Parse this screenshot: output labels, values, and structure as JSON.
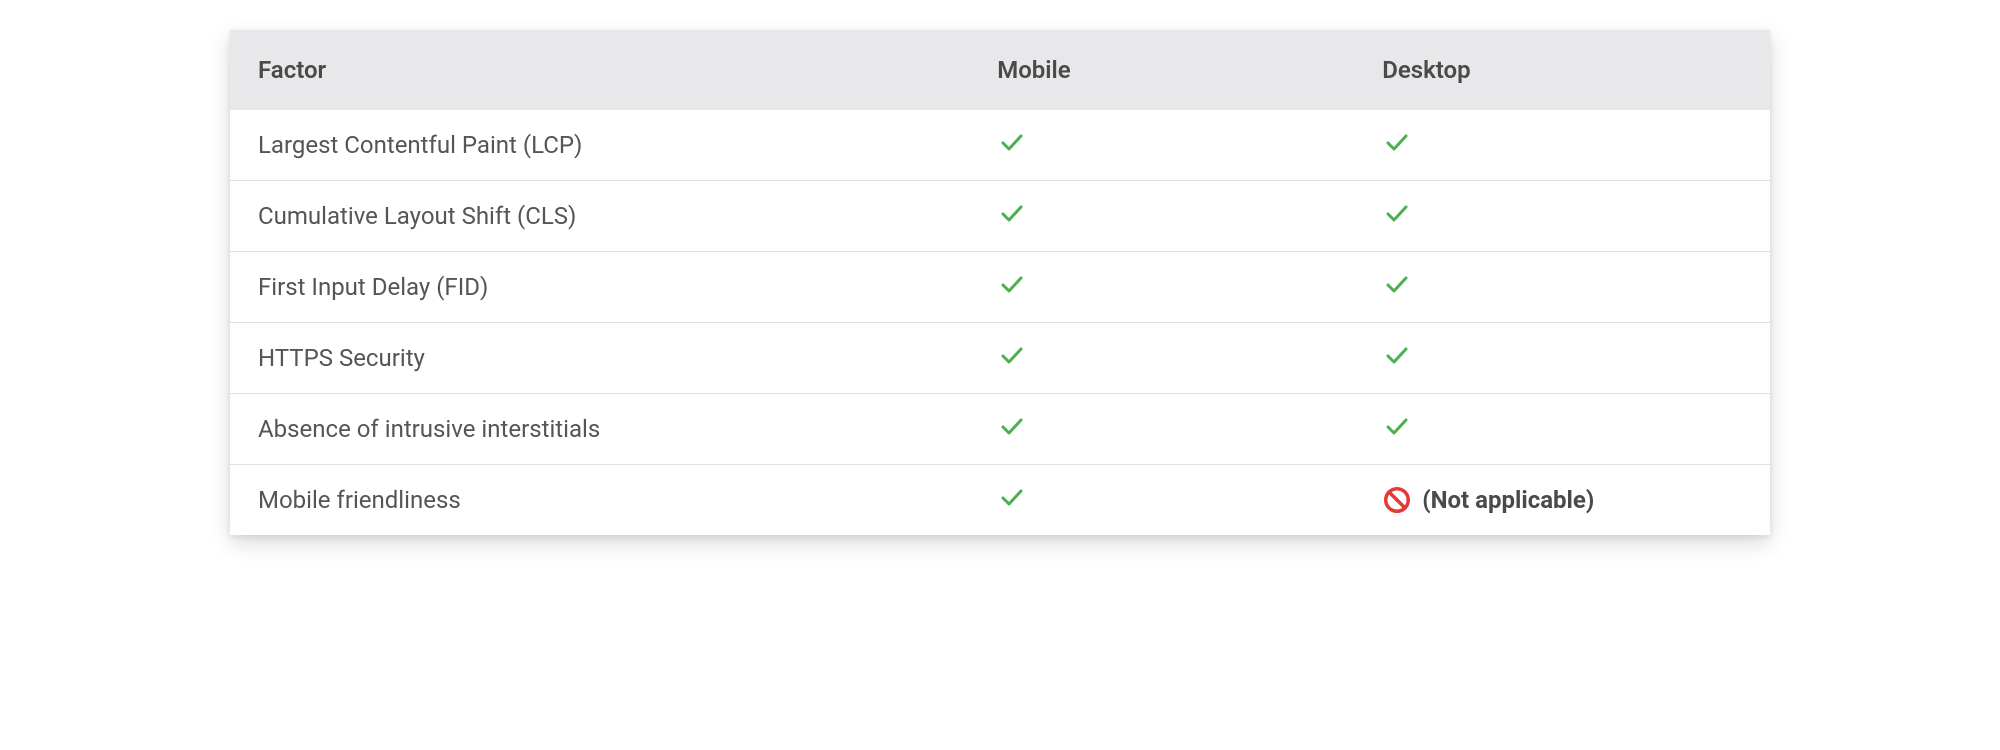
{
  "table": {
    "headers": {
      "factor": "Factor",
      "mobile": "Mobile",
      "desktop": "Desktop"
    },
    "rows": [
      {
        "factor": "Largest Contentful Paint (LCP)",
        "mobile": "check",
        "desktop": "check"
      },
      {
        "factor": "Cumulative Layout Shift (CLS)",
        "mobile": "check",
        "desktop": "check"
      },
      {
        "factor": "First Input Delay (FID)",
        "mobile": "check",
        "desktop": "check"
      },
      {
        "factor": "HTTPS Security",
        "mobile": "check",
        "desktop": "check"
      },
      {
        "factor": "Absence of intrusive interstitials",
        "mobile": "check",
        "desktop": "check"
      },
      {
        "factor": "Mobile friendliness",
        "mobile": "check",
        "desktop": "na"
      }
    ],
    "na_label": "(Not applicable)"
  },
  "colors": {
    "check_green": "#4CAF50",
    "prohibit_red": "#E53935"
  }
}
